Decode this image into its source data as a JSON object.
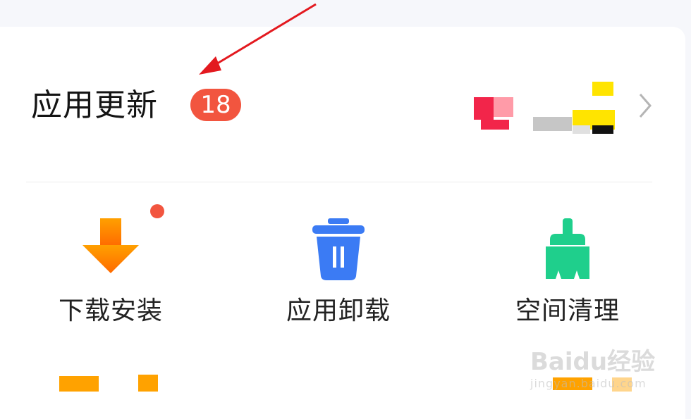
{
  "update": {
    "title": "应用更新",
    "count": "18"
  },
  "tools": [
    {
      "label": "下载安装",
      "icon": "download-icon",
      "color": "#ff8a00"
    },
    {
      "label": "应用卸载",
      "icon": "trash-icon",
      "color": "#3b7bf4"
    },
    {
      "label": "空间清理",
      "icon": "broom-icon",
      "color": "#1fcf8c"
    }
  ],
  "watermark": {
    "brand": "Baidu经验",
    "url": "jingyan.baidu.com"
  },
  "colors": {
    "badge": "#f2553f",
    "annotation_arrow": "#e3191f"
  }
}
